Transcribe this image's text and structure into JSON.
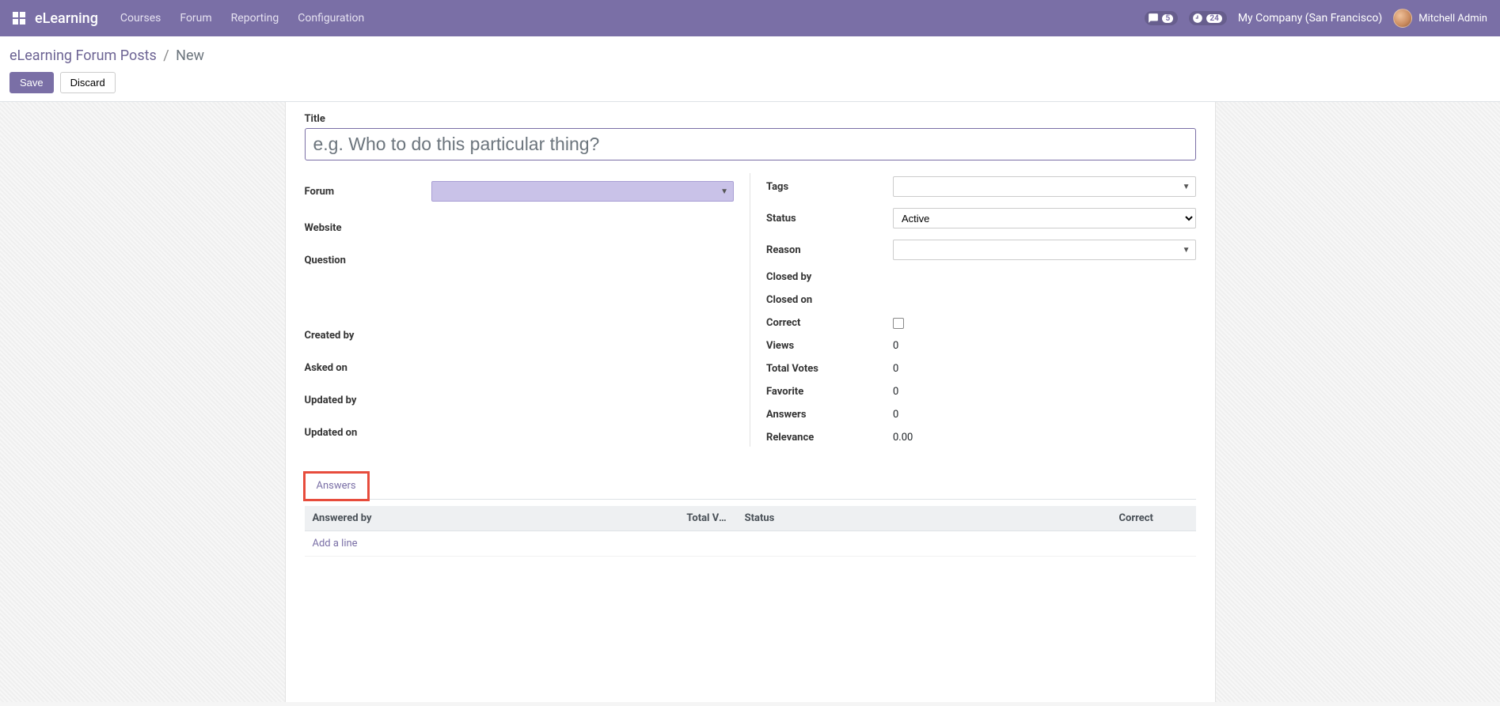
{
  "nav": {
    "brand": "eLearning",
    "menu": [
      "Courses",
      "Forum",
      "Reporting",
      "Configuration"
    ],
    "messages_count": "5",
    "activities_count": "24",
    "company": "My Company (San Francisco)",
    "user": "Mitchell Admin"
  },
  "breadcrumb": {
    "root": "eLearning Forum Posts",
    "current": "New"
  },
  "buttons": {
    "save": "Save",
    "discard": "Discard"
  },
  "form": {
    "title_label": "Title",
    "title_placeholder": "e.g. Who to do this particular thing?",
    "left_labels": {
      "forum": "Forum",
      "website": "Website",
      "question": "Question",
      "created_by": "Created by",
      "asked_on": "Asked on",
      "updated_by": "Updated by",
      "updated_on": "Updated on"
    },
    "right_labels": {
      "tags": "Tags",
      "status": "Status",
      "reason": "Reason",
      "closed_by": "Closed by",
      "closed_on": "Closed on",
      "correct": "Correct",
      "views": "Views",
      "total_votes": "Total Votes",
      "favorite": "Favorite",
      "answers": "Answers",
      "relevance": "Relevance"
    },
    "status_value": "Active",
    "stats": {
      "views": "0",
      "total_votes": "0",
      "favorite": "0",
      "answers": "0",
      "relevance": "0.00"
    }
  },
  "notebook": {
    "tab_answers": "Answers",
    "columns": {
      "answered_by": "Answered by",
      "total_votes": "Total Vo…",
      "status": "Status",
      "correct": "Correct"
    },
    "add_line": "Add a line"
  }
}
